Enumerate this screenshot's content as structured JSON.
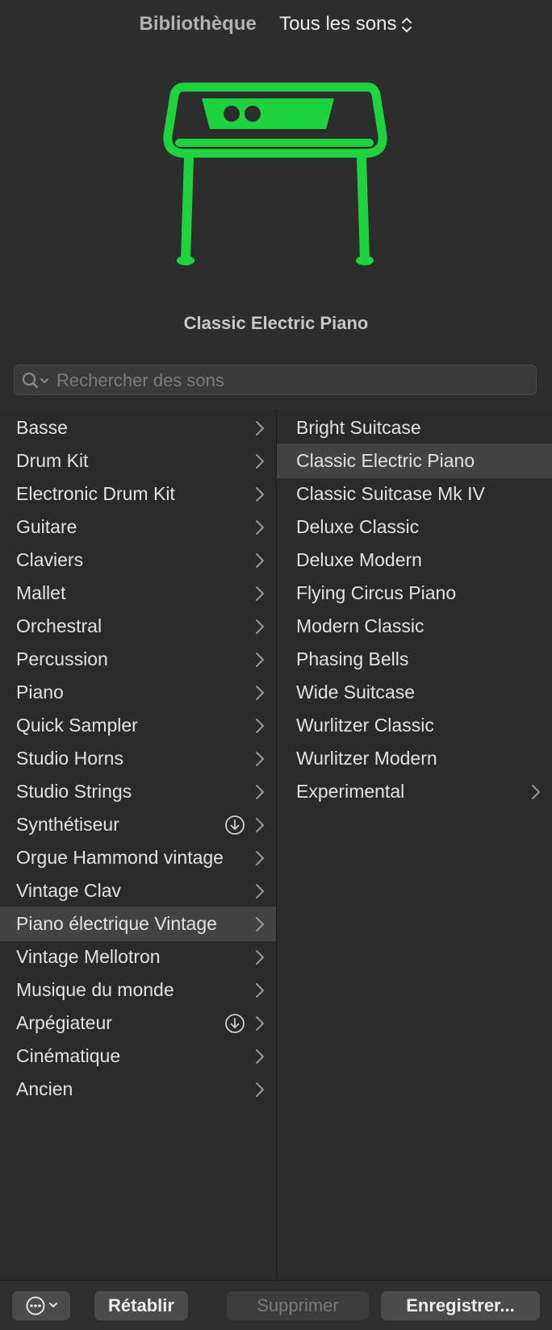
{
  "header": {
    "library_label": "Bibliothèque",
    "filter_value": "Tous les sons",
    "instrument_name": "Classic Electric Piano",
    "accent_color": "#1fd33f"
  },
  "search": {
    "placeholder": "Rechercher des sons",
    "value": ""
  },
  "categories": [
    {
      "label": "Basse",
      "selected": false,
      "download": false
    },
    {
      "label": "Drum Kit",
      "selected": false,
      "download": false
    },
    {
      "label": "Electronic Drum Kit",
      "selected": false,
      "download": false
    },
    {
      "label": "Guitare",
      "selected": false,
      "download": false
    },
    {
      "label": "Claviers",
      "selected": false,
      "download": false
    },
    {
      "label": "Mallet",
      "selected": false,
      "download": false
    },
    {
      "label": "Orchestral",
      "selected": false,
      "download": false
    },
    {
      "label": "Percussion",
      "selected": false,
      "download": false
    },
    {
      "label": "Piano",
      "selected": false,
      "download": false
    },
    {
      "label": "Quick Sampler",
      "selected": false,
      "download": false
    },
    {
      "label": "Studio Horns",
      "selected": false,
      "download": false
    },
    {
      "label": "Studio Strings",
      "selected": false,
      "download": false
    },
    {
      "label": "Synthétiseur",
      "selected": false,
      "download": true
    },
    {
      "label": "Orgue Hammond vintage",
      "selected": false,
      "download": false
    },
    {
      "label": "Vintage Clav",
      "selected": false,
      "download": false
    },
    {
      "label": "Piano électrique Vintage",
      "selected": true,
      "download": false
    },
    {
      "label": "Vintage Mellotron",
      "selected": false,
      "download": false
    },
    {
      "label": "Musique du monde",
      "selected": false,
      "download": false
    },
    {
      "label": "Arpégiateur",
      "selected": false,
      "download": true
    },
    {
      "label": "Cinématique",
      "selected": false,
      "download": false
    },
    {
      "label": "Ancien",
      "selected": false,
      "download": false
    }
  ],
  "sounds": [
    {
      "label": "Bright Suitcase",
      "selected": false,
      "folder": false
    },
    {
      "label": "Classic Electric Piano",
      "selected": true,
      "folder": false
    },
    {
      "label": "Classic Suitcase Mk IV",
      "selected": false,
      "folder": false
    },
    {
      "label": "Deluxe Classic",
      "selected": false,
      "folder": false
    },
    {
      "label": "Deluxe Modern",
      "selected": false,
      "folder": false
    },
    {
      "label": "Flying Circus Piano",
      "selected": false,
      "folder": false
    },
    {
      "label": "Modern Classic",
      "selected": false,
      "folder": false
    },
    {
      "label": "Phasing Bells",
      "selected": false,
      "folder": false
    },
    {
      "label": "Wide Suitcase",
      "selected": false,
      "folder": false
    },
    {
      "label": "Wurlitzer Classic",
      "selected": false,
      "folder": false
    },
    {
      "label": "Wurlitzer Modern",
      "selected": false,
      "folder": false
    },
    {
      "label": "Experimental",
      "selected": false,
      "folder": true
    }
  ],
  "footer": {
    "menu_icon": "ellipsis-circle-icon",
    "revert_label": "Rétablir",
    "delete_label": "Supprimer",
    "save_label": "Enregistrer..."
  }
}
